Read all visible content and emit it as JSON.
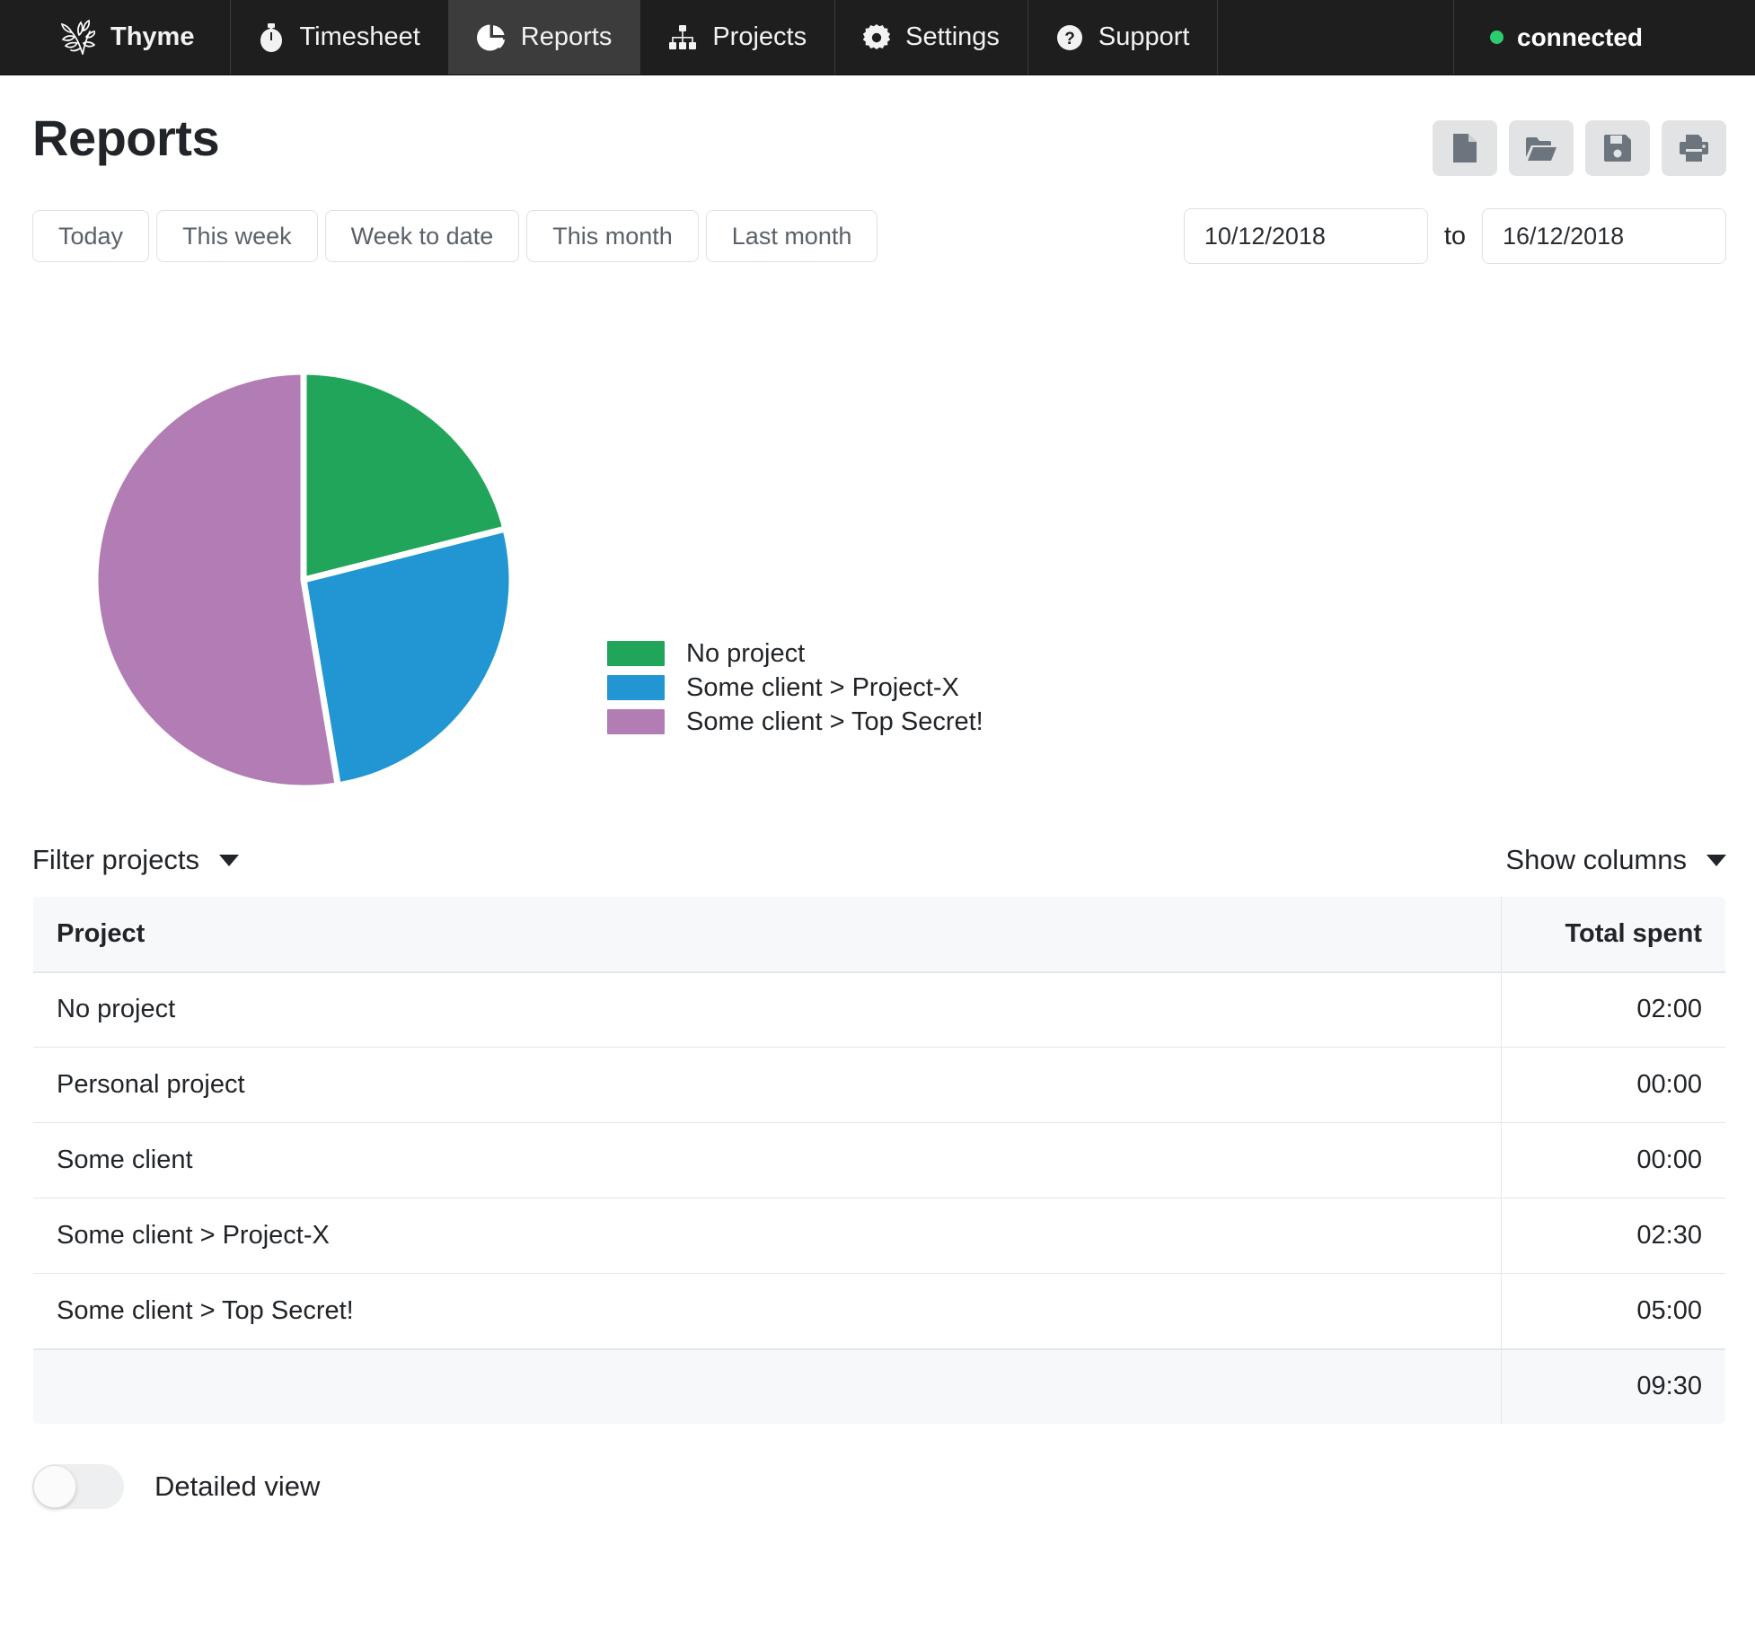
{
  "navbar": {
    "brand": {
      "label": "Thyme",
      "icon": "herb-sprig-icon"
    },
    "items": [
      {
        "label": "Timesheet",
        "icon": "stopwatch-icon",
        "active": false
      },
      {
        "label": "Reports",
        "icon": "pie-chart-icon",
        "active": true
      },
      {
        "label": "Projects",
        "icon": "org-chart-icon",
        "active": false
      },
      {
        "label": "Settings",
        "icon": "gear-icon",
        "active": false
      },
      {
        "label": "Support",
        "icon": "question-circle-icon",
        "active": false
      }
    ],
    "status": {
      "label": "connected",
      "dot_color": "#2ecc71"
    }
  },
  "header": {
    "title": "Reports",
    "toolbar": [
      {
        "name": "new-report-button",
        "icon": "document-icon"
      },
      {
        "name": "open-report-button",
        "icon": "folder-open-icon"
      },
      {
        "name": "save-report-button",
        "icon": "floppy-disk-icon"
      },
      {
        "name": "print-report-button",
        "icon": "printer-icon"
      }
    ]
  },
  "date_filter": {
    "presets": [
      "Today",
      "This week",
      "Week to date",
      "This month",
      "Last month"
    ],
    "from_value": "10/12/2018",
    "from_placeholder": "dd/mm/yyyy",
    "to_label": "to",
    "to_value": "16/12/2018",
    "to_placeholder": "dd/mm/yyyy"
  },
  "chart_data": {
    "type": "pie",
    "title": "",
    "legend_position": "right",
    "categories": [
      "No project",
      "Some client > Project-X",
      "Some client > Top Secret!"
    ],
    "values": [
      2.0,
      2.5,
      5.0
    ],
    "value_labels": [
      "02:00",
      "02:30",
      "05:00"
    ],
    "percentages": [
      21.05,
      26.32,
      52.63
    ],
    "colors": [
      "#21a55a",
      "#2196d3",
      "#b27cb4"
    ],
    "units": "hours",
    "start_angle_deg": 90,
    "direction": "clockwise",
    "total": 9.5,
    "total_label": "09:30"
  },
  "table_controls": {
    "filter_label": "Filter projects",
    "columns_label": "Show columns"
  },
  "table": {
    "headers": [
      "Project",
      "Total spent"
    ],
    "rows": [
      {
        "project": "No project",
        "total": "02:00"
      },
      {
        "project": "Personal project",
        "total": "00:00"
      },
      {
        "project": "Some client",
        "total": "00:00"
      },
      {
        "project": "Some client > Project-X",
        "total": "02:30"
      },
      {
        "project": "Some client > Top Secret!",
        "total": "05:00"
      }
    ],
    "footer": {
      "project": "",
      "total": "09:30"
    }
  },
  "detailed_view": {
    "label": "Detailed view",
    "enabled": false
  }
}
